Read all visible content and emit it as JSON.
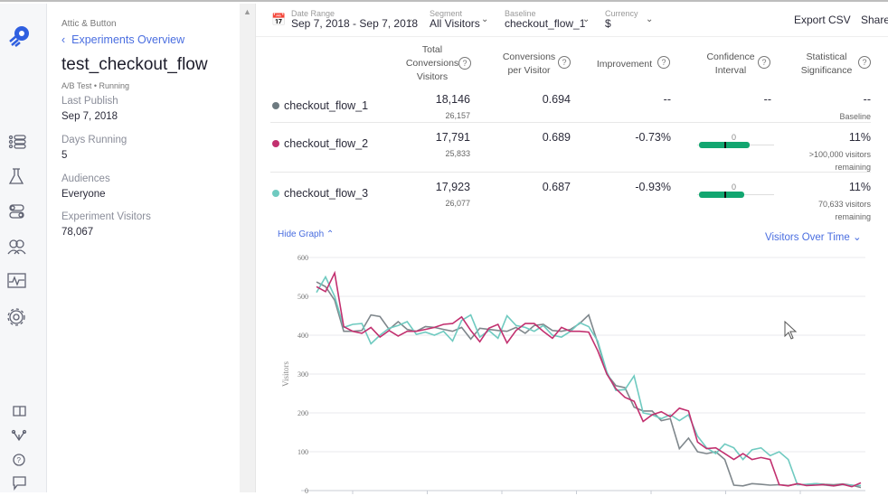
{
  "rail": {
    "icons": [
      "logo-icon",
      "list-icon",
      "flask-icon",
      "toggle-icon",
      "audience-icon",
      "activity-icon",
      "settings-icon",
      "book-icon",
      "flow-icon",
      "help-icon",
      "chat-icon"
    ]
  },
  "sidebar": {
    "org": "Attic & Button",
    "back": "Experiments Overview",
    "title": "test_checkout_flow",
    "type": "A/B Test",
    "status": "Running",
    "fields": [
      {
        "label": "Last Publish",
        "value": "Sep 7, 2018"
      },
      {
        "label": "Days Running",
        "value": "5"
      },
      {
        "label": "Audiences",
        "value": "Everyone"
      },
      {
        "label": "Experiment Visitors",
        "value": "78,067"
      }
    ]
  },
  "header": {
    "date_range": {
      "label": "Date Range",
      "value": "Sep 7, 2018 - Sep 7, 2018"
    },
    "segment": {
      "label": "Segment",
      "value": "All Visitors"
    },
    "baseline": {
      "label": "Baseline",
      "value": "checkout_flow_1"
    },
    "currency": {
      "label": "Currency",
      "value": "$"
    },
    "export": "Export CSV",
    "share": "Share"
  },
  "table": {
    "headers": {
      "total": [
        "Total",
        "Conversions",
        "Visitors"
      ],
      "cpv": [
        "Conversions",
        "per Visitor"
      ],
      "improvement": "Improvement",
      "ci": [
        "Confidence",
        "Interval"
      ],
      "sig": [
        "Statistical",
        "Significance"
      ]
    },
    "rows": [
      {
        "name": "checkout_flow_1",
        "color": "#6d7a80",
        "conversions": "18,146",
        "visitors": "26,157",
        "cpv": "0.694",
        "improvement": "--",
        "ci": "--",
        "sig": "--",
        "sig_note": "Baseline",
        "sig_note2": ""
      },
      {
        "name": "checkout_flow_2",
        "color": "#c2306f",
        "conversions": "17,791",
        "visitors": "25,833",
        "cpv": "0.689",
        "improvement": "-0.73%",
        "ci_zero": "0",
        "sig": "11%",
        "sig_note": ">100,000 visitors",
        "sig_note2": "remaining"
      },
      {
        "name": "checkout_flow_3",
        "color": "#6fcac0",
        "conversions": "17,923",
        "visitors": "26,077",
        "cpv": "0.687",
        "improvement": "-0.93%",
        "ci_zero": "0",
        "sig": "11%",
        "sig_note": "70,633 visitors",
        "sig_note2": "remaining"
      }
    ]
  },
  "graph": {
    "hide": "Hide Graph",
    "metric": "Visitors Over Time"
  },
  "chart_data": {
    "type": "line",
    "ylabel": "Visitors",
    "ylim": [
      0,
      600
    ],
    "yticks": [
      "0",
      "100",
      "200",
      "300",
      "400",
      "500",
      "600"
    ],
    "grid": true,
    "series": [
      {
        "name": "checkout_flow_1",
        "color": "#7f878c",
        "values": [
          537,
          525,
          490,
          410,
          410,
          412,
          452,
          448,
          415,
          435,
          415,
          410,
          422,
          420,
          415,
          410,
          420,
          390,
          418,
          415,
          412,
          410,
          420,
          405,
          425,
          428,
          412,
          410,
          415,
          430,
          452,
          380,
          300,
          270,
          265,
          215,
          205,
          205,
          180,
          185,
          108,
          135,
          100,
          95,
          100,
          80,
          14,
          12,
          18,
          16,
          14,
          15,
          13,
          17,
          14,
          18,
          16,
          15,
          17,
          14,
          8
        ]
      },
      {
        "name": "checkout_flow_2",
        "color": "#c2306f",
        "values": [
          525,
          512,
          560,
          422,
          410,
          405,
          420,
          395,
          412,
          398,
          410,
          410,
          415,
          420,
          428,
          430,
          447,
          412,
          383,
          418,
          428,
          380,
          412,
          430,
          430,
          410,
          392,
          420,
          410,
          410,
          408,
          360,
          300,
          262,
          240,
          230,
          178,
          195,
          203,
          190,
          212,
          205,
          125,
          108,
          110,
          95,
          80,
          95,
          80,
          85,
          80,
          15,
          12,
          18,
          13,
          14,
          15,
          12,
          16,
          10,
          20
        ]
      },
      {
        "name": "checkout_flow_3",
        "color": "#6fcac0",
        "values": [
          510,
          550,
          500,
          420,
          428,
          430,
          378,
          400,
          418,
          425,
          435,
          402,
          408,
          400,
          410,
          385,
          438,
          452,
          395,
          412,
          392,
          450,
          425,
          420,
          410,
          425,
          400,
          395,
          410,
          432,
          422,
          385,
          305,
          258,
          260,
          295,
          200,
          195,
          185,
          195,
          180,
          195,
          140,
          110,
          95,
          120,
          110,
          80,
          105,
          110,
          90,
          100,
          80,
          15,
          16,
          18,
          14,
          12,
          15,
          14,
          13
        ]
      }
    ]
  }
}
